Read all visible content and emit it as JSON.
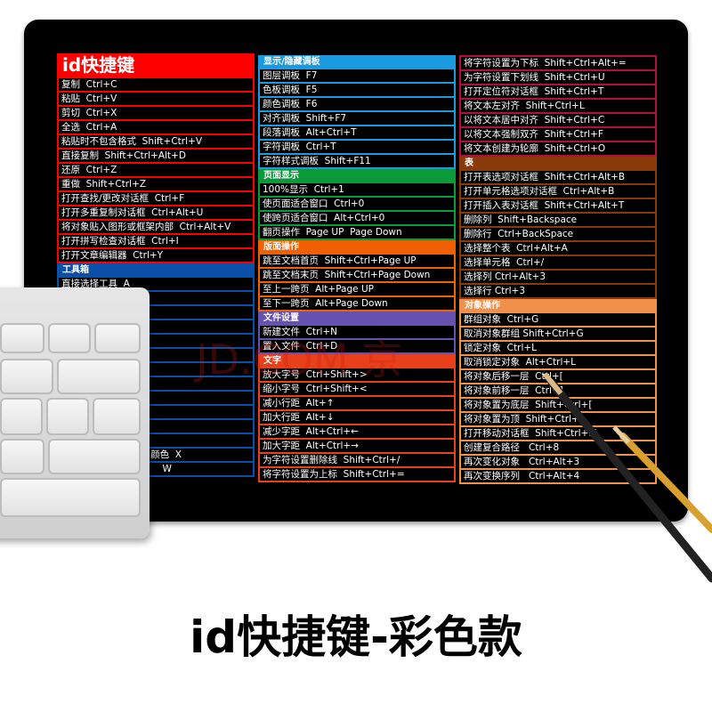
{
  "watermark": "JD.COM 京",
  "bottom_title": "id快捷键-彩色款",
  "columns": [
    {
      "sections": [
        {
          "title": "id快捷键",
          "color": "#ff0000",
          "big": true,
          "rows": [
            "复制  Ctrl+C",
            "粘贴  Ctrl+V",
            "剪切  Ctrl+X",
            "全选  Ctrl+A",
            "粘贴时不包含格式  Shift+Ctrl+V",
            "直接复制  Shift+Ctrl+Alt+D",
            "还原  Ctrl+Z",
            "重做  Shift+Ctrl+Z",
            "打开查找/更改对话框  Ctrl+F",
            "打开多重复制对话框  Ctrl+Alt+U",
            "将对象贴入图形或框架内部  Ctrl+Alt+V",
            "打开拼写检查对话框  Ctrl+I",
            "打开文章编辑器  Ctrl+Y"
          ]
        },
        {
          "title": "工具箱",
          "color": "#0a4fa8",
          "rows": [
            "直接选择工具  A",
            "",
            "",
            "",
            "",
            "",
            "",
            "",
            "",
            "",
            "",
            "",
            "                              颜色  X",
            "                                  W"
          ]
        }
      ]
    },
    {
      "sections": [
        {
          "title": "显示/隐藏调板",
          "color": "#1a9be0",
          "rows": [
            "图层调板  F7",
            "色板调板  F5",
            "颜色调板  F6",
            "对齐调板  Shift+F7",
            "段落调板  Alt+Ctrl+T",
            "字符调板  Ctrl+T",
            "字符样式调板  Shift+F11"
          ]
        },
        {
          "title": "页面显示",
          "color": "#0a9a3a",
          "rows": [
            "100%显示  Ctrl+1",
            "使页面适合窗口  Ctrl+0",
            "使跨页适合窗口  Alt+Ctrl+0",
            "翻页操作  Page UP  Page Down"
          ]
        },
        {
          "title": "版面操作",
          "color": "#f06000",
          "rows": [
            "跳至文档首页  Shift+Ctrl+Page UP",
            "跳至文档末页  Shift+Ctrl+Page Down",
            "至上一跨页  Alt+Page UP",
            "至下一跨页  Alt+Page Down"
          ]
        },
        {
          "title": "文件设置",
          "color": "#6650b0",
          "rows": [
            "新建文件  Ctrl+N",
            "置入文件  Ctrl+D"
          ]
        },
        {
          "title": "文字",
          "color": "#e8401a",
          "rows": [
            "放大字号  Ctrl+Shift+>",
            "缩小字号  Ctrl+Shift+<",
            "减小行距  Alt+↑",
            "加大行距  Alt+↓",
            "减少字距  Alt+Ctrl+←",
            "加大字距  Alt+Ctrl+→",
            "为字符设置删除线  Shift+Ctrl+/",
            "将字符设置为上标  Shift+Ctrl+="
          ]
        }
      ]
    },
    {
      "sections": [
        {
          "title": "",
          "color": "#b0103a",
          "rows": [
            "将字符设置为下标  Shift+Ctrl+Alt+=",
            "为字符设置下划线  Shift+Ctrl+U",
            "打开定位符对话框  Shift+Ctrl+T",
            "将文本左对齐  Shift+Ctrl+L",
            "以将文本居中对齐  Shift+Ctrl+C",
            "以将文本强制双齐  Shift+Ctrl+F",
            "将文本创建为轮廓  Shift+Ctrl+O"
          ]
        },
        {
          "title": "表",
          "color": "#8a3a08",
          "rows": [
            "打开表选项对话框  Shift+Ctrl+Alt+B",
            "打开单元格选项对话框  Ctrl+Alt+B",
            "打开插入表对话框  Shift+Ctrl+Alt+T",
            "删除列  Shift+Backspace",
            "删除行  Ctrl+BackSpace",
            "选择整个表  Ctrl+Alt+A",
            "选择单元格  Ctrl+/",
            "选择列 Ctrl+Alt+3",
            "选择行 Ctrl+3"
          ]
        },
        {
          "title": "对象操作",
          "color": "#f0904a",
          "rows": [
            "群组对象  Ctrl+G",
            "取消对象群组 Shift+Ctrl+G",
            "锁定对象  Ctrl+L",
            "取消锁定对象  Alt+Ctrl+L",
            "将对象后移一层  Ctrl+[",
            "将对象前移一层  Ctrl+]",
            "将对象置为底层  Shift+Ctrl+[",
            "将对象置为顶  Shift+Ctrl+]",
            "打开移动对话框  Shift+Ctrl+M",
            "创建复合路径   Ctrl+8",
            "再次变化对象   Ctrl+Alt+3",
            "再次变换序列   Ctrl+Alt+4"
          ]
        }
      ]
    }
  ]
}
